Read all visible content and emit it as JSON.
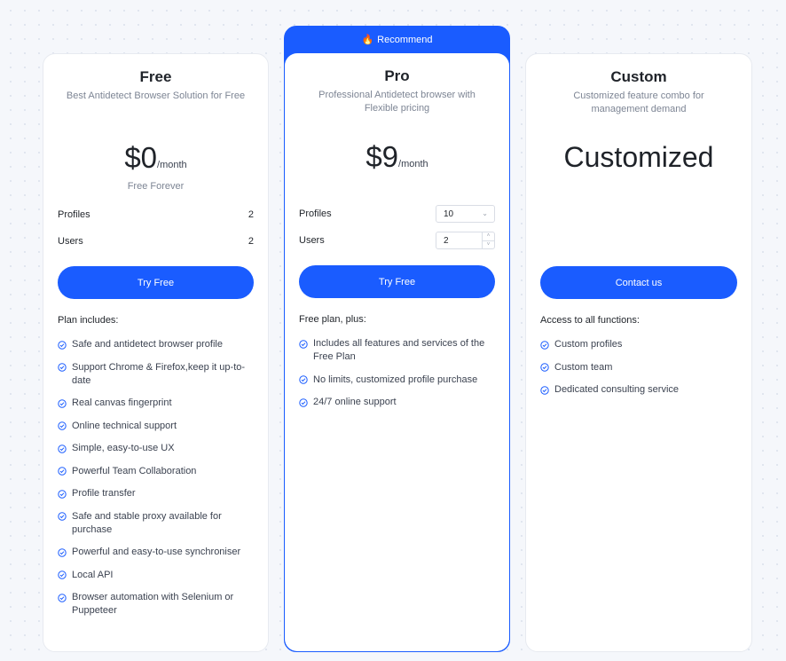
{
  "colors": {
    "accent": "#1a5cff",
    "text": "#1f2329",
    "muted": "#7d8594",
    "background": "#f5f7fb"
  },
  "plans": [
    {
      "name": "Free",
      "desc": "Best Antidetect Browser Solution for Free",
      "price": "$0",
      "per": "/month",
      "note": "Free Forever",
      "profiles_label": "Profiles",
      "profiles_value": "2",
      "users_label": "Users",
      "users_value": "2",
      "button": "Try Free",
      "includes_title": "Plan includes:",
      "features": [
        "Safe and antidetect browser profile",
        "Support Chrome & Firefox,keep it up-to-date",
        "Real canvas fingerprint",
        "Online technical support",
        "Simple, easy-to-use UX",
        "Powerful Team Collaboration",
        "Profile transfer",
        "Safe and stable proxy available for purchase",
        "Powerful and easy-to-use synchroniser",
        "Local API",
        "Browser automation with Selenium or Puppeteer"
      ]
    },
    {
      "ribbon": "Recommend",
      "ribbon_icon": "fire-icon",
      "name": "Pro",
      "desc": "Professional Antidetect browser with Flexible pricing",
      "price": "$9",
      "per": "/month",
      "profiles_label": "Profiles",
      "profiles_value": "10",
      "users_label": "Users",
      "users_value": "2",
      "button": "Try Free",
      "includes_title": "Free plan, plus:",
      "features": [
        "Includes all features and services of the Free Plan",
        "No limits, customized profile purchase",
        "24/7 online support"
      ]
    },
    {
      "name": "Custom",
      "desc": "Customized feature combo for management demand",
      "price_text": "Customized",
      "button": "Contact us",
      "includes_title": "Access to all functions:",
      "features": [
        "Custom profiles",
        "Custom team",
        "Dedicated consulting service"
      ]
    }
  ]
}
